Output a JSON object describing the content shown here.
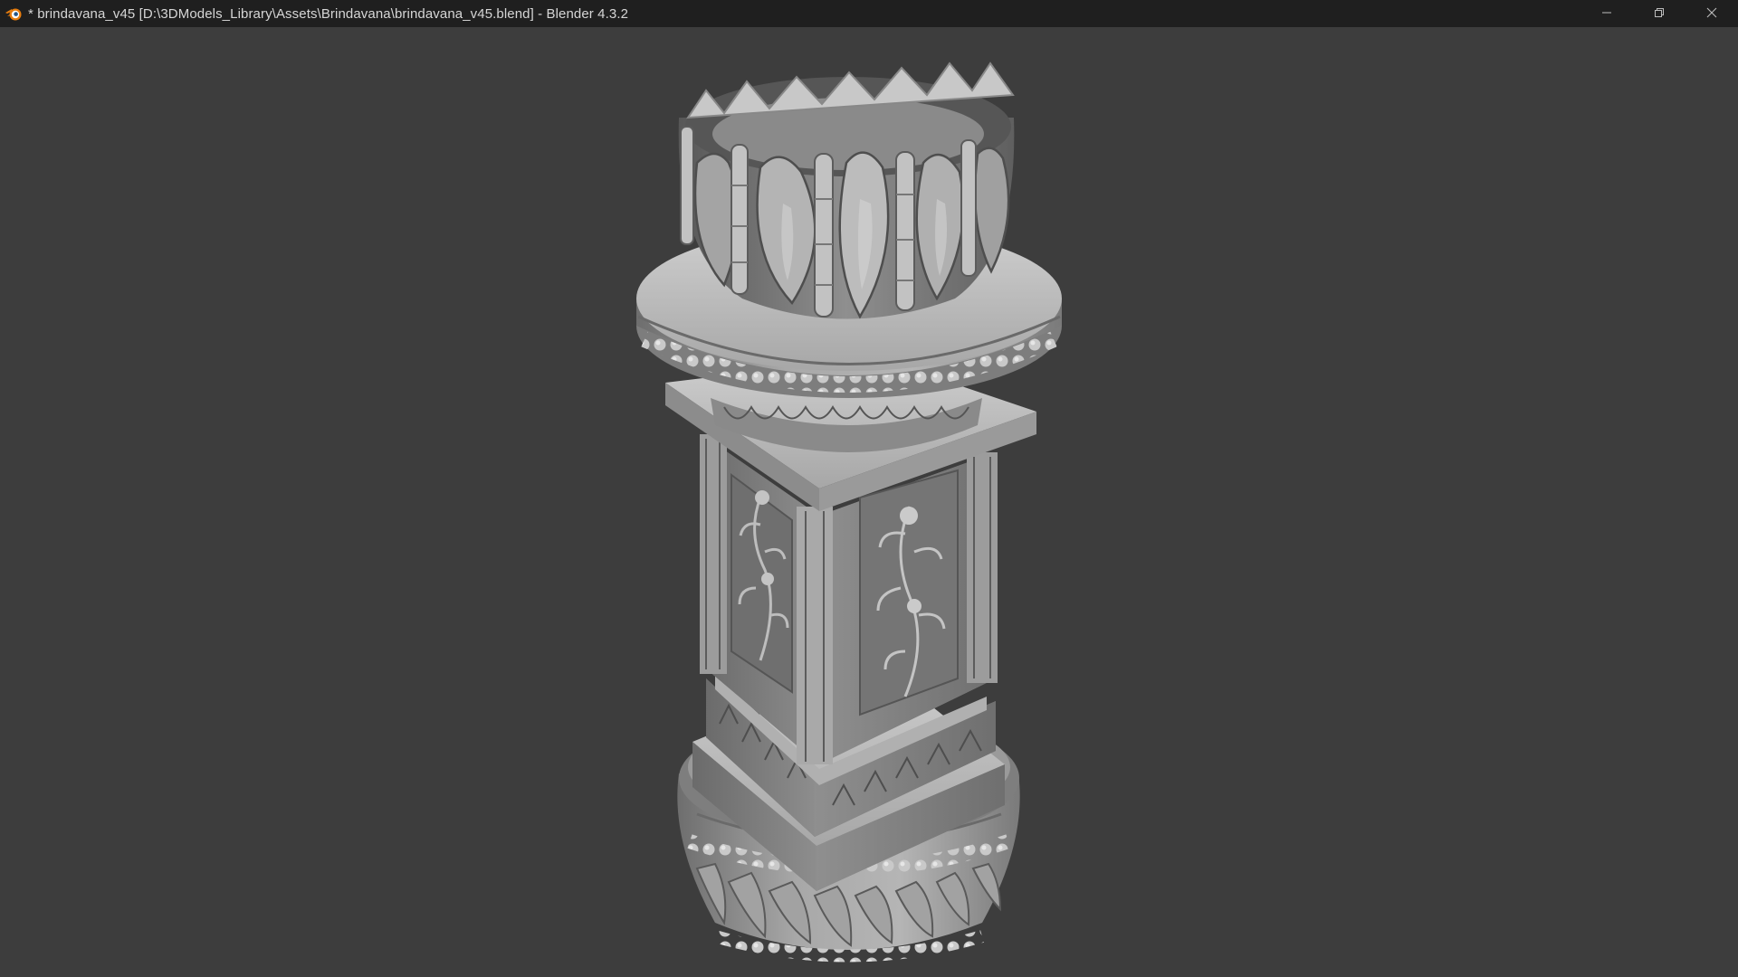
{
  "window": {
    "title": "* brindavana_v45 [D:\\3DModels_Library\\Assets\\Brindavana\\brindavana_v45.blend] - Blender 4.3.2",
    "app_icon": "blender-logo-icon"
  },
  "controls": {
    "minimize_icon": "minimize-icon",
    "restore_icon": "restore-icon",
    "close_icon": "close-icon"
  },
  "viewport": {
    "background_color": "#3d3d3d",
    "object": "brindavana-pillar-model"
  }
}
